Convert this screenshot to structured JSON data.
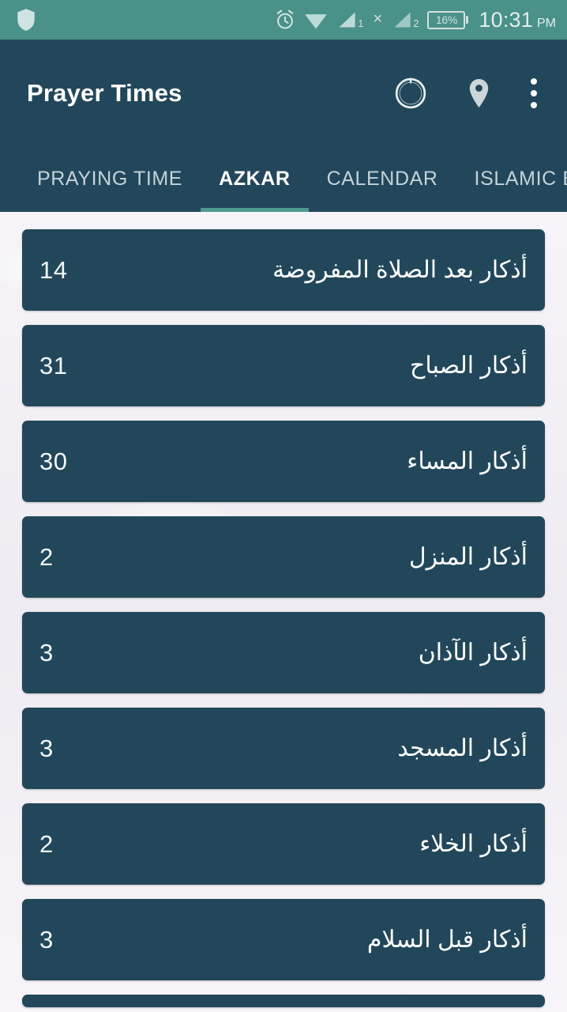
{
  "status_bar": {
    "background_color": "#4a9189",
    "text_color": "#dff0ed",
    "shield_icon": "shield-icon",
    "alarm_icon": "alarm-icon",
    "wifi_icon": "wifi-icon",
    "signal1_icon": "signal-bars-icon",
    "signal1_label": "1",
    "no_service_mark": "×",
    "signal2_icon": "signal-bars-icon",
    "signal2_label": "2",
    "battery_percent": "16%",
    "time": "10:31",
    "am_pm": "PM"
  },
  "app_bar": {
    "title": "Prayer Times",
    "background_color": "#22475a",
    "actions": [
      {
        "name": "qibla-compass-button",
        "icon": "compass-icon"
      },
      {
        "name": "location-button",
        "icon": "location-pin-icon"
      },
      {
        "name": "overflow-menu-button",
        "icon": "more-vertical-icon"
      }
    ]
  },
  "tabs": {
    "active_index": 1,
    "indicator_color": "#4f9a91",
    "items": [
      {
        "label": "PRAYING TIME"
      },
      {
        "label": "AZKAR"
      },
      {
        "label": "CALENDAR"
      },
      {
        "label": "ISLAMIC B"
      }
    ]
  },
  "azkar_list": {
    "card_color": "#22475a",
    "background_color": "#f4f2f6",
    "items": [
      {
        "title": "أذكار بعد الصلاة المفروضة",
        "count": "14"
      },
      {
        "title": "أذكار الصباح",
        "count": "31"
      },
      {
        "title": "أذكار المساء",
        "count": "30"
      },
      {
        "title": "أذكار المنزل",
        "count": "2"
      },
      {
        "title": "أذكار الآذان",
        "count": "3"
      },
      {
        "title": "أذكار المسجد",
        "count": "3"
      },
      {
        "title": "أذكار الخلاء",
        "count": "2"
      },
      {
        "title": "أذكار قبل السلام",
        "count": "3"
      }
    ]
  }
}
